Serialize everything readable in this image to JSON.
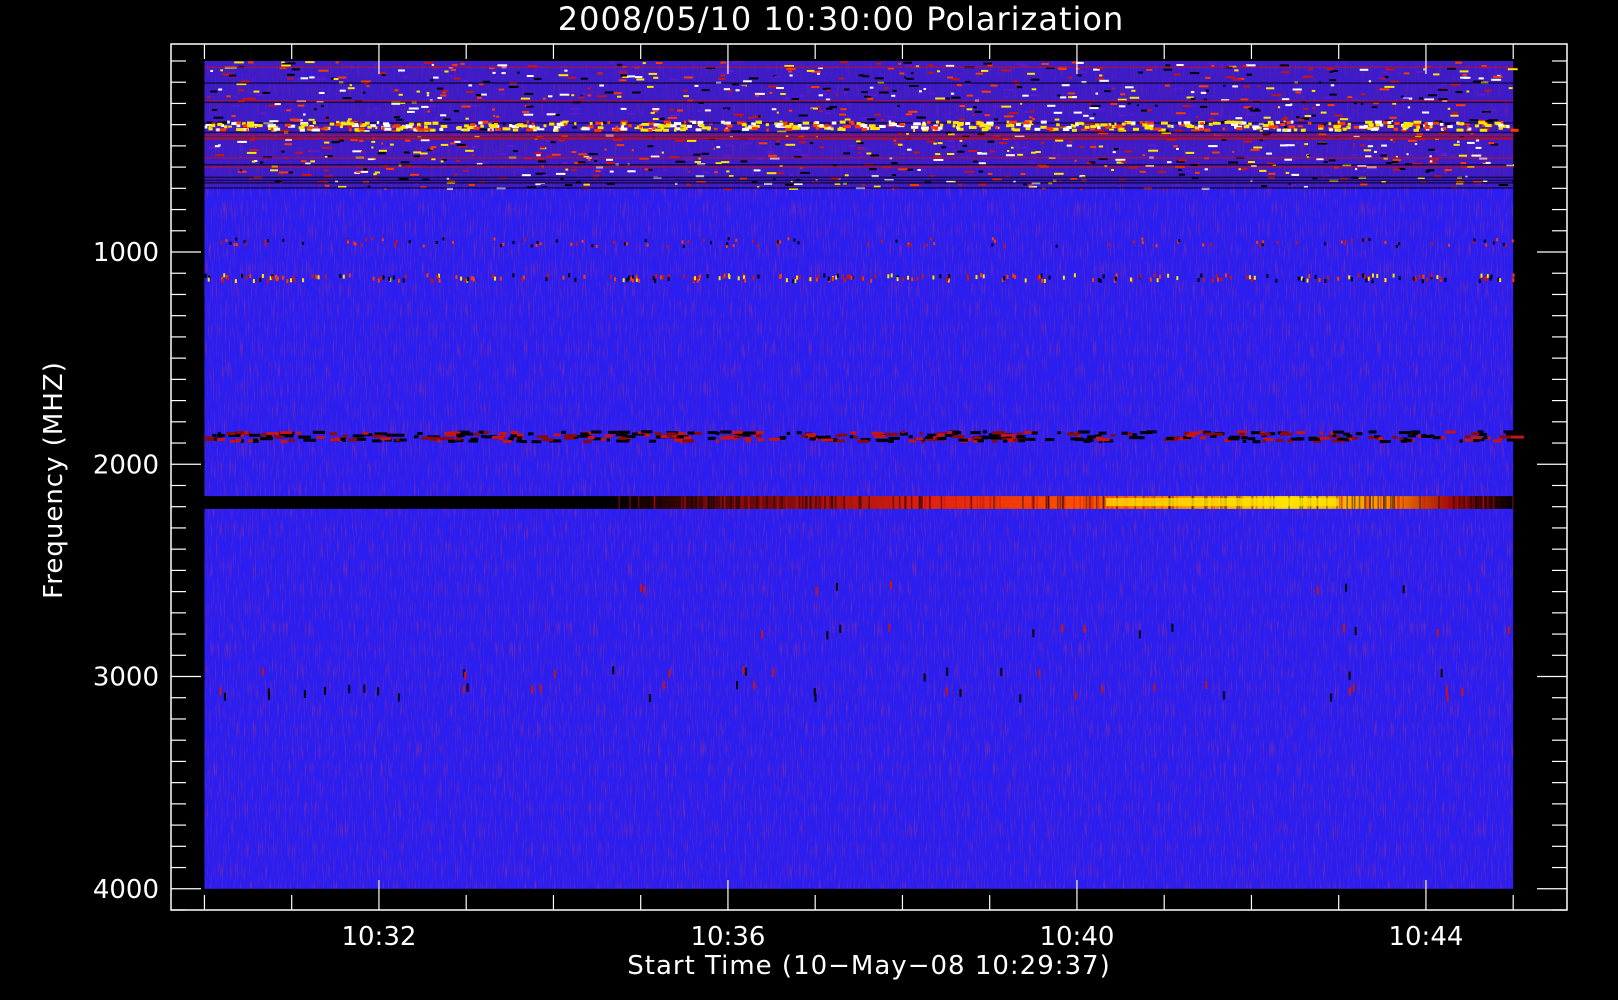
{
  "chart_data": {
    "type": "heatmap",
    "title": "2008/05/10 10:30:00 Polarization",
    "xlabel": "Start Time (10−May−08 10:29:37)",
    "ylabel": "Frequency (MHZ)",
    "x_ticks": [
      "10:32",
      "10:36",
      "10:40",
      "10:44"
    ],
    "y_ticks": [
      1000,
      2000,
      3000,
      4000
    ],
    "xlim": [
      "10:29:37",
      "10:45:37"
    ],
    "ylim": [
      4100,
      20
    ],
    "y_inverted": true,
    "data_time_range": [
      "10:30:00",
      "10:45:00"
    ],
    "data_freq_range": [
      100,
      4000
    ],
    "background_color": "#2a1ef0",
    "colormap": [
      "#000000",
      "#1a10e0",
      "#2a1ef0",
      "#c81414",
      "#ff3a00",
      "#ffe600",
      "#ffffff"
    ],
    "features": [
      {
        "freq_range": [
          100,
          700
        ],
        "time_range": [
          "10:30:00",
          "10:45:00"
        ],
        "level": "noisy mixed red/yellow/black"
      },
      {
        "freq_range": [
          380,
          420
        ],
        "time_range": [
          "10:30:00",
          "10:45:00"
        ],
        "level": "bright yellow/white band"
      },
      {
        "freq_range": [
          1100,
          1140
        ],
        "time_range": [
          "10:30:00",
          "10:45:00"
        ],
        "level": "scattered red/yellow dots"
      },
      {
        "freq_range": [
          1840,
          1900
        ],
        "time_range": [
          "10:30:00",
          "10:45:00"
        ],
        "level": "red/black line"
      },
      {
        "freq_range": [
          2150,
          2210
        ],
        "time_range": [
          "10:30:00",
          "10:34:40"
        ],
        "level": "black gap"
      },
      {
        "freq_range": [
          2150,
          2210
        ],
        "time_range": [
          "10:34:40",
          "10:37:00"
        ],
        "level": "dark red transition"
      },
      {
        "freq_range": [
          2150,
          2210
        ],
        "time_range": [
          "10:37:00",
          "10:43:50"
        ],
        "level": "red to bright yellow peak"
      },
      {
        "freq_range": [
          2150,
          2210
        ],
        "time_range": [
          "10:43:50",
          "10:45:00"
        ],
        "level": "black/red fade"
      }
    ]
  }
}
